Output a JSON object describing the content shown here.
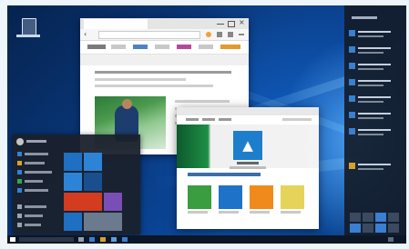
{
  "desktop": {
    "recycle_bin": {
      "icon": "recycle-bin-icon"
    }
  },
  "browser": {
    "back_icon": "‹",
    "nav_pill_colors": [
      "#c8c8c8"
    ],
    "accent": "#f0a23b"
  },
  "store": {
    "app_tile_icon": "▲",
    "tile_color": "#1f7ecb",
    "app_colors": [
      "#3a9d3f",
      "#1e73c9",
      "#f08a1c",
      "#e6d35a"
    ]
  },
  "start_menu": {
    "tile_colors": [
      "#1f6fc2",
      "#1f6fc2",
      "#2d84d6",
      "#d43b1f",
      "#7a4fb5",
      "#1a4f8f"
    ]
  },
  "taskbar": {
    "accent": "#3a7fd0"
  }
}
